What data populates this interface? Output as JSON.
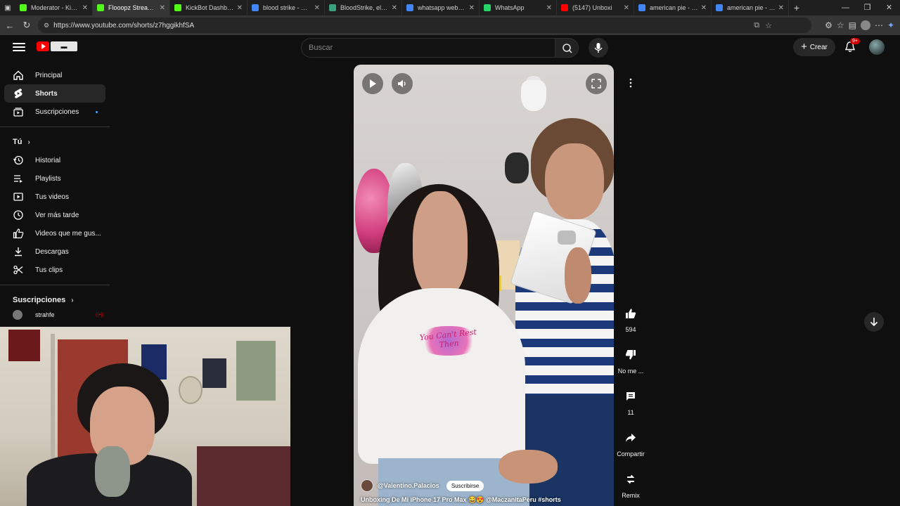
{
  "browser": {
    "tabs": [
      {
        "title": "Moderator - Kick D",
        "color": "#53fc18"
      },
      {
        "title": "Flooopz Stream - V",
        "color": "#53fc18",
        "active": true
      },
      {
        "title": "KickBot Dashboard",
        "color": "#53fc18"
      },
      {
        "title": "blood strike - Búsqu",
        "color": "#4285f4"
      },
      {
        "title": "BloodStrike, el verti",
        "color": "#3aa17e"
      },
      {
        "title": "whatsapp web - Bú",
        "color": "#4285f4"
      },
      {
        "title": "WhatsApp",
        "color": "#25d366"
      },
      {
        "title": "(5147) Unboxi",
        "color": "#ff0000"
      },
      {
        "title": "american pie - Búsq",
        "color": "#4285f4"
      },
      {
        "title": "american pie - Búsq",
        "color": "#4285f4"
      }
    ],
    "new_tab": "+",
    "url": "https://www.youtube.com/shorts/z7hggikhfSA"
  },
  "header": {
    "search_placeholder": "Buscar",
    "create_label": "Crear",
    "notifications_badge": "9+"
  },
  "sidebar": {
    "main": [
      {
        "label": "Principal",
        "icon": "home-icon"
      },
      {
        "label": "Shorts",
        "icon": "shorts-icon",
        "selected": true
      },
      {
        "label": "Suscripciones",
        "icon": "subscriptions-icon",
        "dot": true
      }
    ],
    "you_heading": "Tú",
    "you": [
      {
        "label": "Historial",
        "icon": "history-icon"
      },
      {
        "label": "Playlists",
        "icon": "playlists-icon"
      },
      {
        "label": "Tus videos",
        "icon": "your-videos-icon"
      },
      {
        "label": "Ver más tarde",
        "icon": "watch-later-icon"
      },
      {
        "label": "Videos que me gus...",
        "icon": "liked-icon"
      },
      {
        "label": "Descargas",
        "icon": "downloads-icon"
      },
      {
        "label": "Tus clips",
        "icon": "clips-icon"
      }
    ],
    "subs_heading": "Suscripciones",
    "subs": [
      {
        "label": "strahfe",
        "badge": "((•))"
      }
    ]
  },
  "short": {
    "channel": "@Valentino.Palacios",
    "subscribe_label": "Suscribirse",
    "title": "Unboxing De Mi iPhone 17 Pro Max 😂😍 @MaczanitaPeru #shorts",
    "shirt_text": "You Can't Rest Then"
  },
  "actions": {
    "likes": "594",
    "dislike_label": "No me ...",
    "comments": "11",
    "share_label": "Compartir",
    "remix_label": "Remix"
  }
}
